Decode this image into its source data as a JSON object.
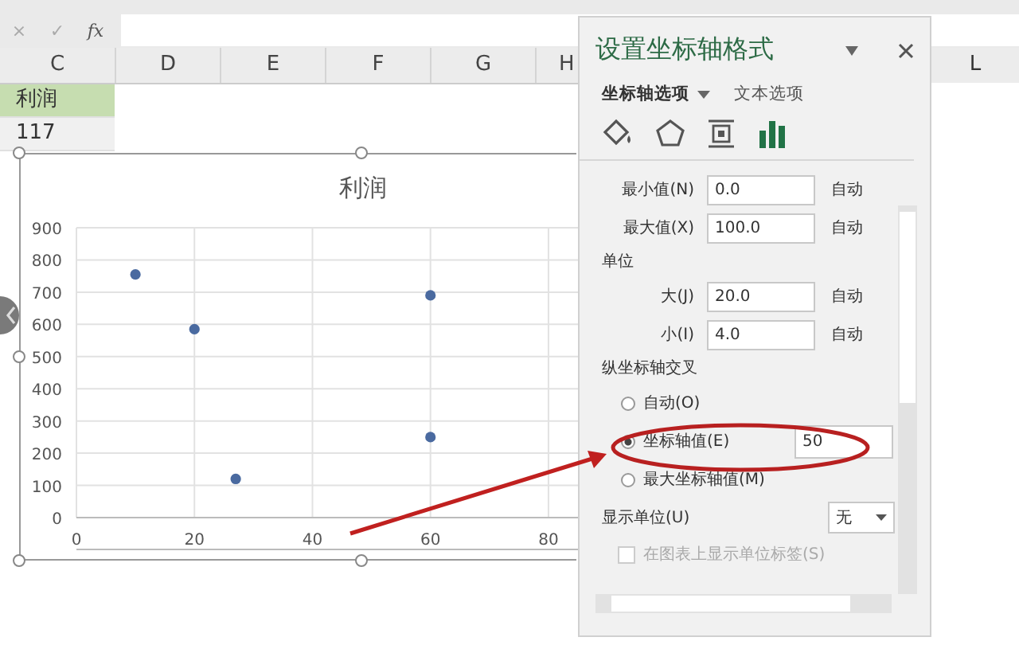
{
  "formula_bar": {
    "cancel": "×",
    "enter": "✓",
    "function": "fx"
  },
  "columns": [
    "C",
    "D",
    "E",
    "F",
    "G",
    "H"
  ],
  "right_column": "L",
  "cells": [
    {
      "text": "利润",
      "selected": true
    },
    {
      "text": "117",
      "selected": false
    }
  ],
  "chart": {
    "title": "利润",
    "chart_data": {
      "type": "scatter",
      "grid": true,
      "x": [
        10,
        20,
        27,
        60,
        60
      ],
      "values": [
        755,
        585,
        120,
        690,
        250
      ],
      "xlim": [
        0,
        85
      ],
      "ylim": [
        0,
        900
      ],
      "xticks": [
        0,
        20,
        40,
        60,
        80
      ],
      "yticks": [
        0,
        100,
        200,
        300,
        400,
        500,
        600,
        700,
        800,
        900
      ]
    }
  },
  "panel": {
    "title": "设置坐标轴格式",
    "tabs": [
      {
        "label": "坐标轴选项",
        "selected": true
      },
      {
        "label": "文本选项",
        "selected": false
      }
    ],
    "icon_tabs": [
      {
        "kind": "fill",
        "selected": false
      },
      {
        "kind": "effects",
        "selected": false
      },
      {
        "kind": "size",
        "selected": false
      },
      {
        "kind": "axis",
        "selected": true
      }
    ],
    "bounds": [
      {
        "label": "最小值(N)",
        "value": "0.0",
        "reset": "自动"
      },
      {
        "label": "最大值(X)",
        "value": "100.0",
        "reset": "自动"
      }
    ],
    "units_heading": "单位",
    "units": [
      {
        "label": "大(J)",
        "value": "20.0",
        "reset": "自动"
      },
      {
        "label": "小(I)",
        "value": "4.0",
        "reset": "自动"
      }
    ],
    "cross_heading": "纵坐标轴交叉",
    "cross_options": [
      {
        "label": "自动(O)",
        "selected": false
      },
      {
        "label": "坐标轴值(E)",
        "selected": true,
        "value": "50"
      },
      {
        "label": "最大坐标轴值(M)",
        "selected": false
      }
    ],
    "display_unit": {
      "label": "显示单位(U)",
      "value": "无"
    },
    "unit_label_checkbox": {
      "label": "在图表上显示单位标签(S)",
      "checked": false,
      "disabled": true
    }
  }
}
